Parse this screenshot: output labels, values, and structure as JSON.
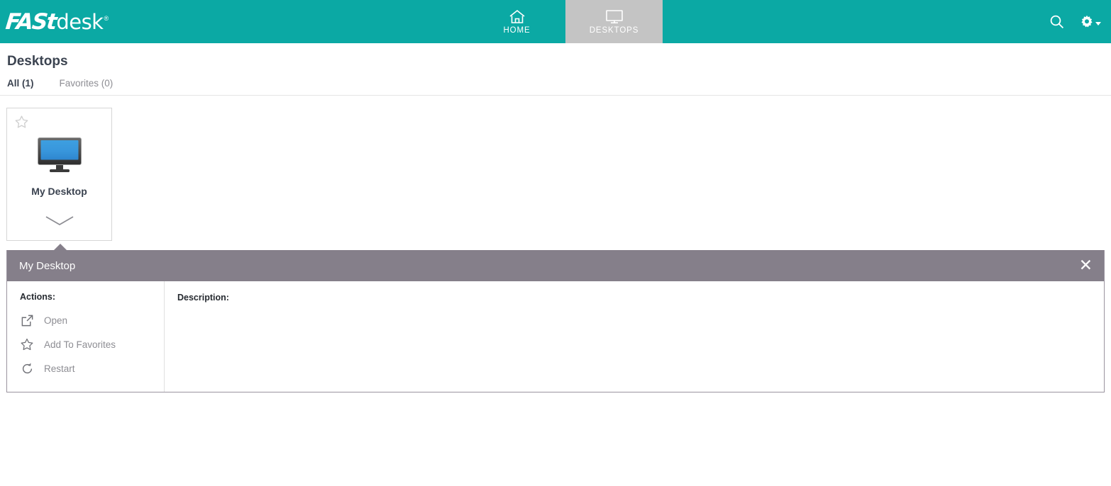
{
  "brand": {
    "logo_mark": "FASt",
    "logo_word": "desk",
    "registered_mark": "®",
    "accent_color": "#0ba9a4"
  },
  "topnav": {
    "items": [
      {
        "label": "HOME",
        "icon": "home-icon",
        "active": false
      },
      {
        "label": "DESKTOPS",
        "icon": "monitor-icon",
        "active": true
      }
    ],
    "search_icon": "search-icon",
    "settings_icon": "gear-icon",
    "settings_caret": "chevron-down-icon",
    "active_tab_color": "#c4c4c4"
  },
  "page": {
    "title": "Desktops",
    "tabs": [
      {
        "label": "All (1)",
        "active": true
      },
      {
        "label": "Favorites (0)",
        "active": false
      }
    ]
  },
  "desktops": [
    {
      "name": "My Desktop",
      "favorite_icon": "star-outline-icon",
      "thumbnail_icon": "monitor-thumbnail-icon",
      "expander_icon": "chevron-down-icon"
    }
  ],
  "detail_panel": {
    "title": "My Desktop",
    "close_icon": "close-icon",
    "actions_label": "Actions:",
    "actions": [
      {
        "label": "Open",
        "icon": "external-link-icon"
      },
      {
        "label": "Add To Favorites",
        "icon": "star-outline-icon"
      },
      {
        "label": "Restart",
        "icon": "restart-icon"
      }
    ],
    "description_label": "Description:",
    "description_value": "",
    "header_color": "#857f8a"
  }
}
